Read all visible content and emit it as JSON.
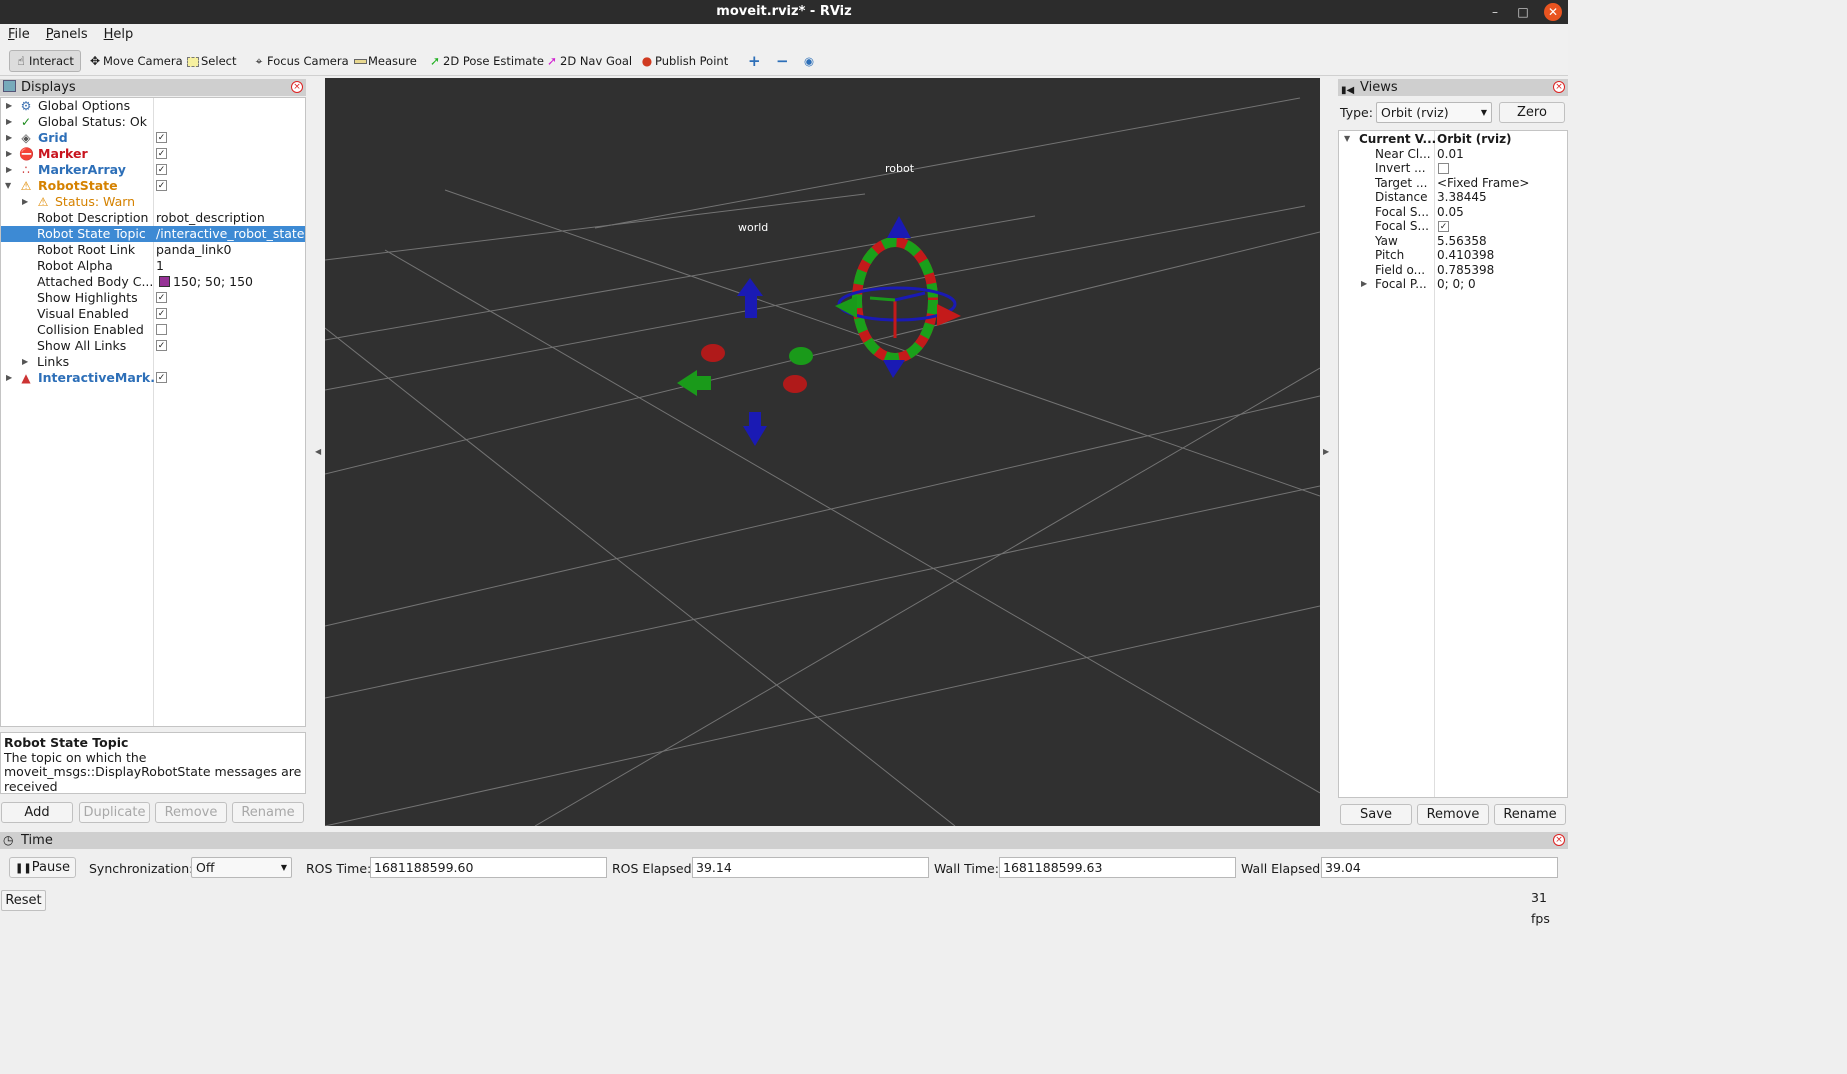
{
  "window": {
    "title": "moveit.rviz* - RViz"
  },
  "menu": [
    "File",
    "Panels",
    "Help"
  ],
  "toolbar": {
    "interact": "Interact",
    "move_camera": "Move Camera",
    "select": "Select",
    "focus_camera": "Focus Camera",
    "measure": "Measure",
    "pose_estimate": "2D Pose Estimate",
    "nav_goal": "2D Nav Goal",
    "publish_point": "Publish Point"
  },
  "displays": {
    "title": "Displays",
    "global_options": "Global Options",
    "global_status": "Global Status: Ok",
    "grid": "Grid",
    "marker": "Marker",
    "marker_array": "MarkerArray",
    "robot_state": "RobotState",
    "status_warn": "Status: Warn",
    "robot_description": {
      "label": "Robot Description",
      "value": "robot_description"
    },
    "robot_state_topic": {
      "label": "Robot State Topic",
      "value": "/interactive_robot_state"
    },
    "robot_root_link": {
      "label": "Robot Root Link",
      "value": "panda_link0"
    },
    "robot_alpha": {
      "label": "Robot Alpha",
      "value": "1"
    },
    "attached_body_color": {
      "label": "Attached Body C...",
      "value": "150; 50; 150",
      "swatch": "#963296"
    },
    "show_highlights": "Show Highlights",
    "visual_enabled": "Visual Enabled",
    "collision_enabled": "Collision Enabled",
    "show_all_links": "Show All Links",
    "links": "Links",
    "interactive_marker": "InteractiveMark..."
  },
  "description": {
    "title": "Robot State Topic",
    "text": "The topic on which the moveit_msgs::DisplayRobotState messages are received"
  },
  "display_buttons": {
    "add": "Add",
    "duplicate": "Duplicate",
    "remove": "Remove",
    "rename": "Rename"
  },
  "viewport": {
    "label_robot": "robot",
    "label_world": "world"
  },
  "views": {
    "title": "Views",
    "type_label": "Type:",
    "type_value": "Orbit (rviz)",
    "zero": "Zero",
    "current_view": {
      "label": "Current V...",
      "value": "Orbit (rviz)"
    },
    "near_clip": {
      "label": "Near Cl...",
      "value": "0.01"
    },
    "invert": {
      "label": "Invert ..."
    },
    "target": {
      "label": "Target ...",
      "value": "<Fixed Frame>"
    },
    "distance": {
      "label": "Distance",
      "value": "3.38445"
    },
    "focal_shape_size": {
      "label": "Focal S...",
      "value": "0.05"
    },
    "focal_shape_fixed": {
      "label": "Focal S..."
    },
    "yaw": {
      "label": "Yaw",
      "value": "5.56358"
    },
    "pitch": {
      "label": "Pitch",
      "value": "0.410398"
    },
    "field_of_view": {
      "label": "Field o...",
      "value": "0.785398"
    },
    "focal_point": {
      "label": "Focal P...",
      "value": "0; 0; 0"
    },
    "save": "Save",
    "remove": "Remove",
    "rename": "Rename"
  },
  "time": {
    "title": "Time",
    "pause": "Pause",
    "sync_label": "Synchronization:",
    "sync_value": "Off",
    "ros_time_label": "ROS Time:",
    "ros_time": "1681188599.60",
    "ros_elapsed_label": "ROS Elapsed:",
    "ros_elapsed": "39.14",
    "wall_time_label": "Wall Time:",
    "wall_time": "1681188599.63",
    "wall_elapsed_label": "Wall Elapsed:",
    "wall_elapsed": "39.04"
  },
  "status": {
    "reset": "Reset",
    "fps": "31 fps"
  }
}
